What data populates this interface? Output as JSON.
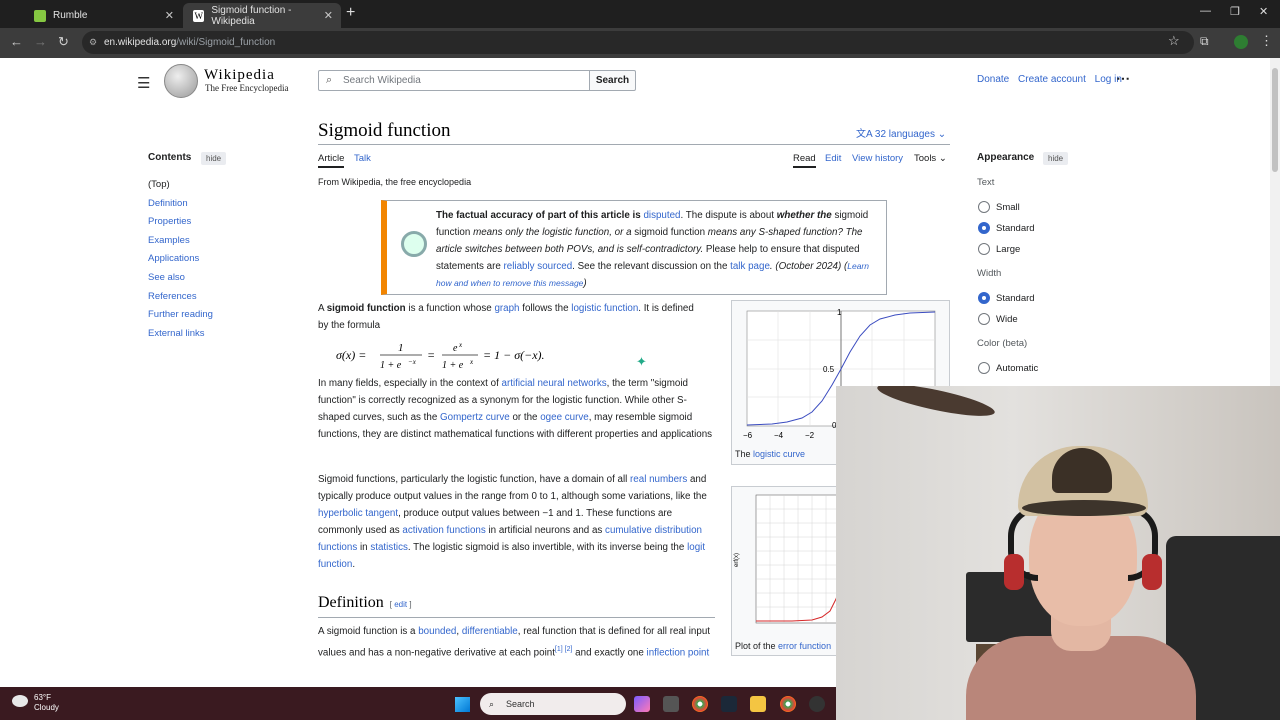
{
  "browser": {
    "tabs": [
      {
        "label": "Rumble"
      },
      {
        "label": "Sigmoid function - Wikipedia"
      }
    ],
    "url_host": "en.wikipedia.org",
    "url_path": "/wiki/Sigmoid_function"
  },
  "wiki": {
    "logo_word": "Wikipedia",
    "logo_tagline": "The Free Encyclopedia",
    "search_placeholder": "Search Wikipedia",
    "search_button": "Search",
    "top_links": [
      "Donate",
      "Create account",
      "Log in"
    ],
    "toc_heading": "Contents",
    "toc_hide": "hide",
    "toc_items": [
      "(Top)",
      "Definition",
      "Properties",
      "Examples",
      "Applications",
      "See also",
      "References",
      "Further reading",
      "External links"
    ],
    "title": "Sigmoid function",
    "languages": "32 languages",
    "tabs_left": [
      "Article",
      "Talk"
    ],
    "tabs_right": [
      "Read",
      "Edit",
      "View history",
      "Tools"
    ],
    "from": "From Wikipedia, the free encyclopedia",
    "ambox": {
      "bold": "The factual accuracy of part of this article is",
      "link": "disputed",
      "rest1": ". The dispute is about",
      "italic1": "whether the",
      "line2a": "sigmoid function",
      "line2b": "means only the logistic function, or a",
      "line2c": "sigmoid function",
      "line2d": "means any S-shaped",
      "line3": "function? The article switches between both POVs, and is self-contradictory.",
      "line3b": "Please help to",
      "line4a": "ensure that disputed statements are",
      "line4link": "reliably sourced",
      "line4b": ". See the relevant discussion on the",
      "line4link2": "talk",
      "line5link": "page",
      "line5": ". (October 2024) (",
      "line5link2": "Learn how and when to remove this message",
      "line5end": ")"
    },
    "p1": {
      "a": "A",
      "bold": "sigmoid function",
      "b": "is a function whose",
      "link1": "graph",
      "c": "follows the",
      "link2": "logistic function",
      "d": ". It is defined by the formula"
    },
    "formula": "σ(x) = 1 / (1 + e^−x) = e^x / (1 + e^x) = 1 − σ(−x).",
    "p2": {
      "a": "In many fields, especially in the context of",
      "link1": "artificial neural networks",
      "b": ", the term \"sigmoid function\" is correctly recognized as a synonym for the logistic function. While other S-shaped curves, such as the",
      "link2": "Gompertz curve",
      "c": "or the",
      "link3": "ogee curve",
      "d": ", may resemble sigmoid functions, they are distinct mathematical functions with different properties and applications"
    },
    "p3": {
      "a": "Sigmoid functions, particularly the logistic function, have a domain of all",
      "link1": "real numbers",
      "b": "and typically produce output values in the range from 0 to 1, although some variations, like the",
      "link2": "hyperbolic tangent",
      "c": ", produce output values between −1 and 1. These functions are commonly used as",
      "link3": "activation functions",
      "d": "in artificial neurons and as",
      "link4": "cumulative distribution functions",
      "e": "in",
      "link5": "statistics",
      "f": ". The logistic sigmoid is also invertible, with its inverse being the",
      "link6": "logit function",
      "g": "."
    },
    "section_definition": "Definition",
    "section_edit": "edit",
    "p4": {
      "a": "A sigmoid function is a",
      "link1": "bounded",
      "b": ",",
      "link2": "differentiable",
      "c": ", real function that is defined for all real input values and has a non-negative derivative at each point",
      "ref": "[1] [2]",
      "d": "and exactly one",
      "link3": "inflection point"
    },
    "figure1": {
      "caption_a": "The",
      "caption_link": "logistic curve",
      "y_ticks": [
        "1",
        "0.5",
        "0"
      ],
      "x_ticks": [
        "−6",
        "−4",
        "−2"
      ]
    },
    "figure2": {
      "caption_a": "Plot of the",
      "caption_link": "error function",
      "y_label": "erf(x)"
    },
    "appearance": {
      "heading": "Appearance",
      "hide": "hide",
      "text_label": "Text",
      "text_options": [
        "Small",
        "Standard",
        "Large"
      ],
      "text_selected": "Standard",
      "width_label": "Width",
      "width_options": [
        "Standard",
        "Wide"
      ],
      "width_selected": "Standard",
      "color_label": "Color (beta)",
      "color_options": [
        "Automatic"
      ]
    }
  },
  "taskbar": {
    "temp": "63°F",
    "condition": "Cloudy",
    "search": "Search"
  }
}
